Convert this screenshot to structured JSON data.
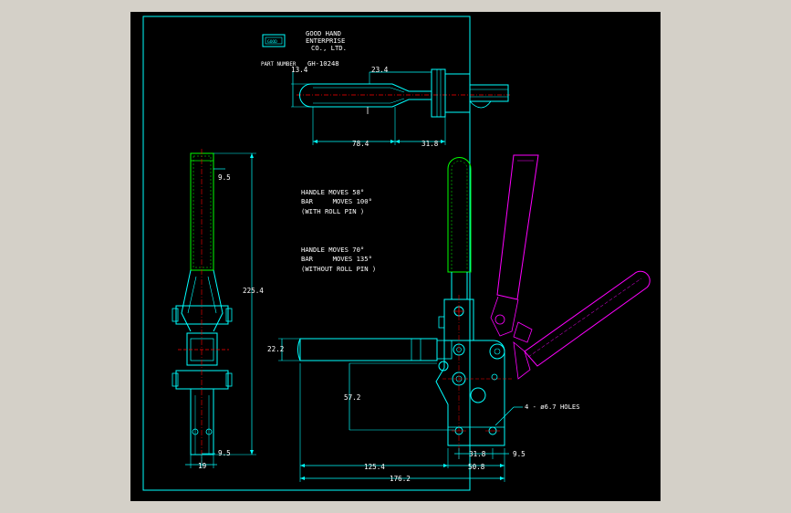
{
  "colors": {
    "background": "#000000",
    "frame": "#00ffff",
    "outline": "#00ffff",
    "handle": "#00ff00",
    "dimension": "#ffffff",
    "centerline": "#ff0000",
    "alt_position": "#ff00ff",
    "text": "#ffffff"
  },
  "title_block": {
    "logo_text": "GOOD",
    "company_line1": "GOOD HAND",
    "company_line2": "ENTERPRISE",
    "company_line3": "CO., LTD.",
    "part_number_label": "PART NUMBER",
    "part_number_value": "GH-10248"
  },
  "notes": {
    "with_pin_line1": "HANDLE MOVES 58°",
    "with_pin_line2": "BAR     MOVES 100°",
    "with_pin_line3": "(WITH ROLL PIN )",
    "without_pin_line1": "HANDLE MOVES 70°",
    "without_pin_line2": "BAR     MOVES 135°",
    "without_pin_line3": "(WITHOUT ROLL PIN )",
    "holes_callout": "4 - ø6.7 HOLES"
  },
  "dimensions": {
    "top_13_4": "13.4",
    "top_23_4": "23.4",
    "top_78_4": "78.4",
    "top_31_8": "31.8",
    "side_9_5_top": "9.5",
    "side_225_4": "225.4",
    "side_9_5_bottom": "9.5",
    "side_19": "19",
    "front_22_2": "22.2",
    "front_57_2": "57.2",
    "front_31_8": "31.8",
    "front_9_5": "9.5",
    "front_125_4": "125.4",
    "front_50_8": "50.8",
    "front_176_2": "176.2"
  }
}
